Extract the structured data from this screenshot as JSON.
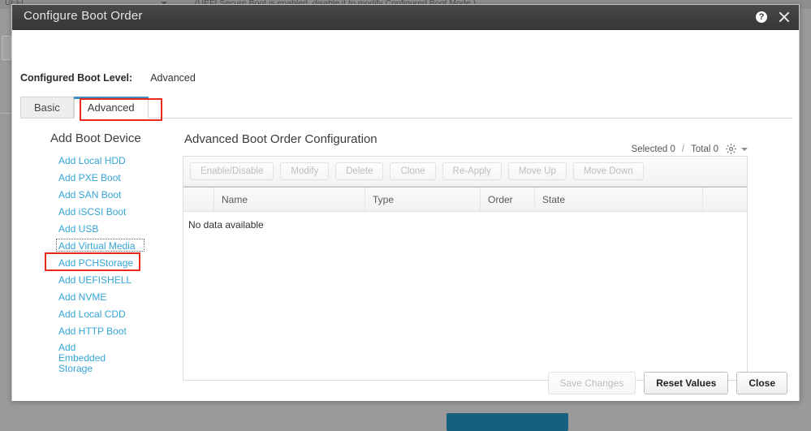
{
  "background": {
    "notice_text": "(UEFI Secure Boot is enabled, disable it to modify Configured Boot Mode.)",
    "uefi_label": "UEFI"
  },
  "modal": {
    "title": "Configure Boot Order",
    "help_icon": "question-mark-icon",
    "close_icon": "close-icon",
    "boot_level": {
      "label": "Configured Boot Level:",
      "value": "Advanced"
    },
    "tabs": [
      {
        "label": "Basic",
        "active": false
      },
      {
        "label": "Advanced",
        "active": true
      }
    ],
    "sidebar": {
      "title": "Add Boot Device",
      "items": [
        {
          "label": "Add Local HDD"
        },
        {
          "label": "Add PXE Boot"
        },
        {
          "label": "Add SAN Boot"
        },
        {
          "label": "Add iSCSI Boot"
        },
        {
          "label": "Add USB"
        },
        {
          "label": "Add Virtual Media"
        },
        {
          "label": "Add PCHStorage"
        },
        {
          "label": "Add UEFISHELL"
        },
        {
          "label": "Add NVME"
        },
        {
          "label": "Add Local CDD"
        },
        {
          "label": "Add HTTP Boot"
        },
        {
          "label": "Add Embedded Storage"
        }
      ]
    },
    "main": {
      "heading": "Advanced Boot Order Configuration",
      "selected_label": "Selected 0",
      "separator": "/",
      "total_label": "Total 0",
      "settings_icon": "gear-icon",
      "settings_caret": "chevron-down-icon",
      "toolbar": [
        {
          "label": "Enable/Disable",
          "enabled": false
        },
        {
          "label": "Modify",
          "enabled": false
        },
        {
          "label": "Delete",
          "enabled": false
        },
        {
          "label": "Clone",
          "enabled": false
        },
        {
          "label": "Re-Apply",
          "enabled": false
        },
        {
          "label": "Move Up",
          "enabled": false
        },
        {
          "label": "Move Down",
          "enabled": false
        }
      ],
      "table": {
        "columns": [
          "",
          "Name",
          "Type",
          "Order",
          "State",
          ""
        ],
        "rows": [],
        "empty_message": "No data available"
      }
    },
    "footer": [
      {
        "label": "Save Changes",
        "enabled": false
      },
      {
        "label": "Reset Values",
        "enabled": true
      },
      {
        "label": "Close",
        "enabled": true
      }
    ]
  },
  "annotations": {
    "accent_color": "#e8291d",
    "link_color": "#35a5d6",
    "tab_accent_color": "#3f8fc0"
  }
}
